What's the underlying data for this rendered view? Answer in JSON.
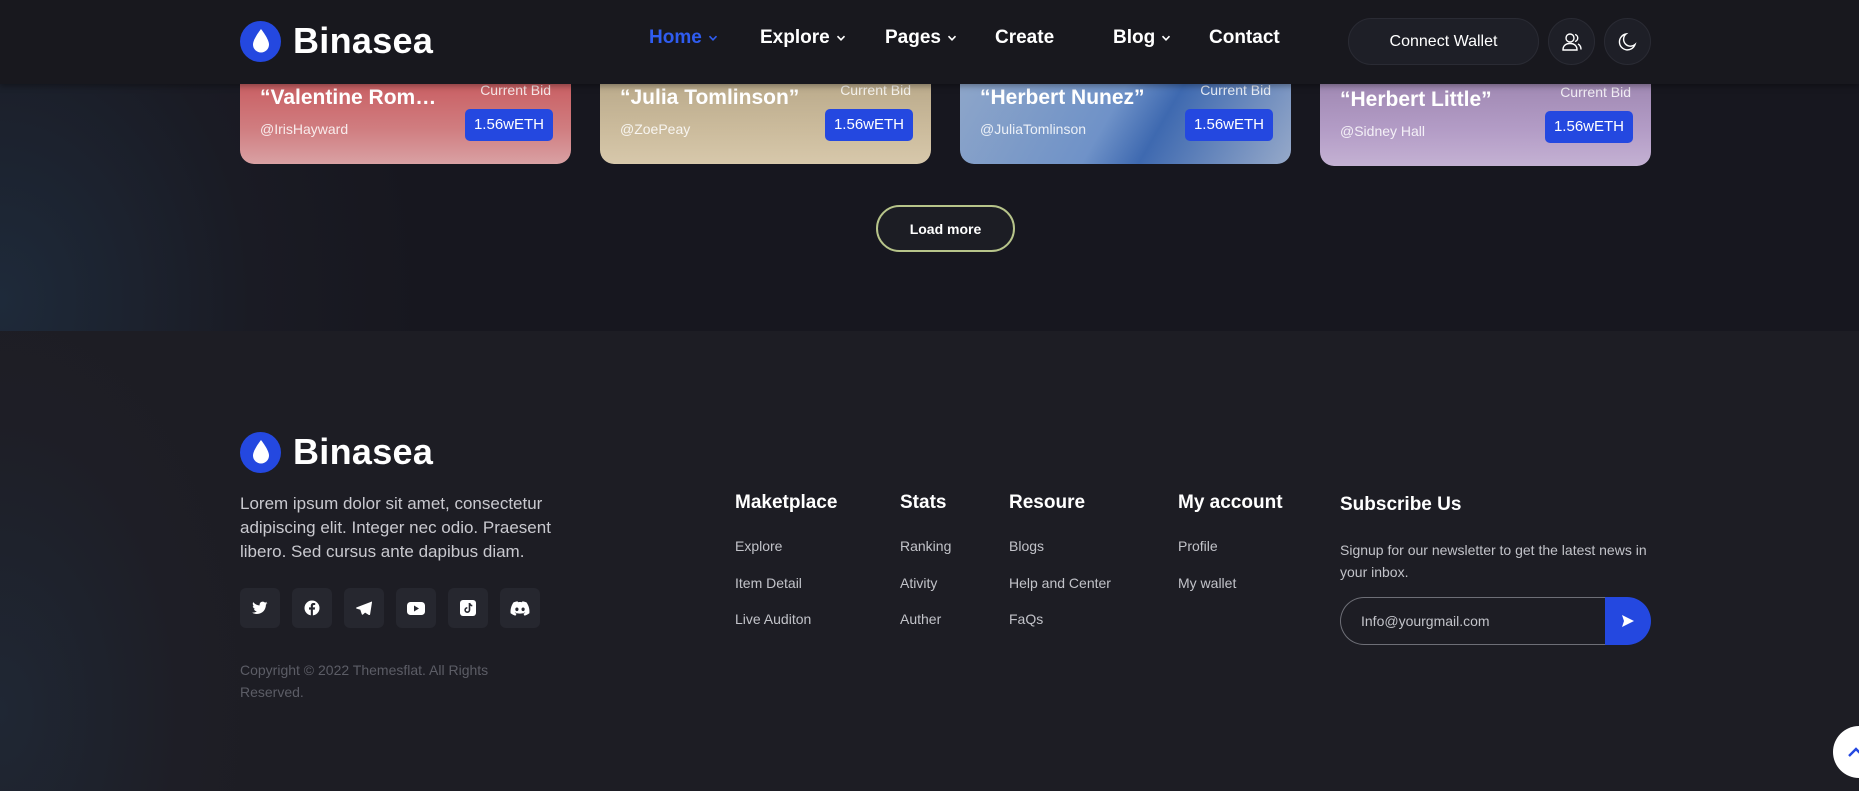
{
  "brand": {
    "name": "Binasea",
    "accent": "#2448e0"
  },
  "nav": {
    "items": [
      {
        "label": "Home",
        "active": true,
        "dropdown": true
      },
      {
        "label": "Explore",
        "active": false,
        "dropdown": true
      },
      {
        "label": "Pages",
        "active": false,
        "dropdown": true
      },
      {
        "label": "Create",
        "active": false,
        "dropdown": false
      },
      {
        "label": "Blog",
        "active": false,
        "dropdown": true
      },
      {
        "label": "Contact",
        "active": false,
        "dropdown": false
      }
    ],
    "connect_wallet": "Connect Wallet",
    "user_icon": "users-icon",
    "theme_icon": "moon-icon"
  },
  "cards": [
    {
      "title": "“Valentine Romer…",
      "handle": "@IrisHayward",
      "bid_label": "Current Bid",
      "price": "1.56wETH"
    },
    {
      "title": "“Julia Tomlinson”",
      "handle": "@ZoePeay",
      "bid_label": "Current Bid",
      "price": "1.56wETH"
    },
    {
      "title": "“Herbert Nunez”",
      "handle": "@JuliaTomlinson",
      "bid_label": "Current Bid",
      "price": "1.56wETH"
    },
    {
      "title": "“Herbert Little”",
      "handle": "@Sidney Hall",
      "bid_label": "Current Bid",
      "price": "1.56wETH"
    }
  ],
  "load_more": "Load more",
  "footer": {
    "description": "Lorem ipsum dolor sit amet, consectetur adipiscing elit. Integer nec odio. Praesent libero. Sed cursus ante dapibus diam.",
    "socials": [
      "twitter-icon",
      "facebook-icon",
      "telegram-icon",
      "youtube-icon",
      "tiktok-icon",
      "discord-icon"
    ],
    "copyright": "Copyright © 2022 Themesflat. All Rights Reserved.",
    "columns": [
      {
        "title": "Maketplace",
        "links": [
          "Explore",
          "Item Detail",
          "Live Auditon"
        ]
      },
      {
        "title": "Stats",
        "links": [
          "Ranking",
          "Ativity",
          "Auther"
        ]
      },
      {
        "title": "Resoure",
        "links": [
          "Blogs",
          "Help and Center",
          "FaQs"
        ]
      },
      {
        "title": "My account",
        "links": [
          "Profile",
          "My wallet"
        ]
      }
    ],
    "subscribe": {
      "title": "Subscribe Us",
      "text": "Signup for our newsletter to get the latest news in your inbox.",
      "placeholder": "Info@yourgmail.com"
    }
  }
}
